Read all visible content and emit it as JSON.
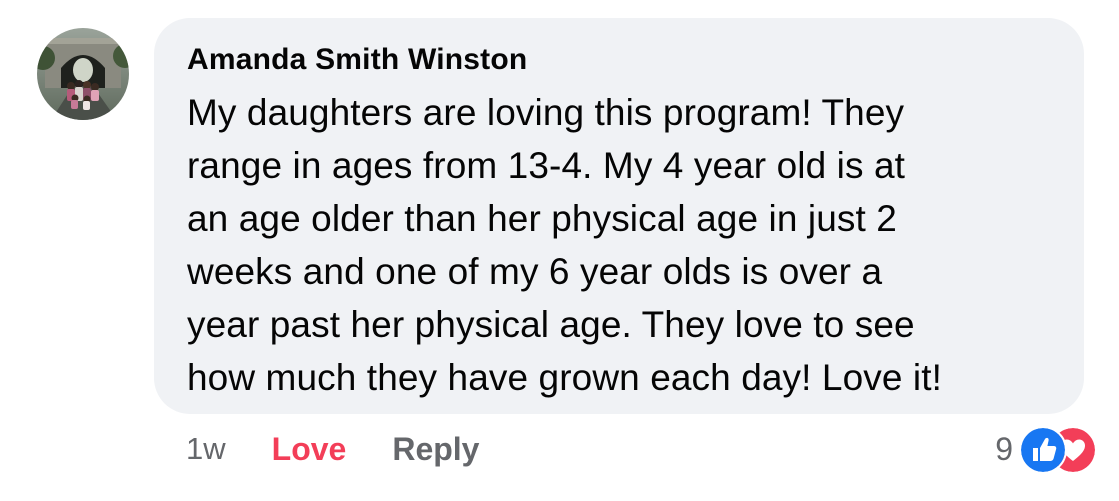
{
  "comment": {
    "author": "Amanda Smith Winston",
    "lines": [
      "My daughters are loving this program! They",
      "range in ages from 13-4. My 4 year old is at",
      "an age older than her physical age in just 2",
      "weeks and one of my 6 year olds is over a",
      "year past her physical age. They love to see",
      "how much they have grown each day! Love it!"
    ],
    "avatar_icon": "profile-photo"
  },
  "actions": {
    "timestamp": "1w",
    "love_label": "Love",
    "reply_label": "Reply"
  },
  "reactions": {
    "count": "9",
    "icons": [
      "like-icon",
      "heart-icon"
    ]
  },
  "colors": {
    "bubble_bg": "#f0f2f5",
    "love": "#f33e58",
    "muted": "#65676b",
    "like_blue": "#1877f2",
    "heart_red": "#f33e58"
  }
}
